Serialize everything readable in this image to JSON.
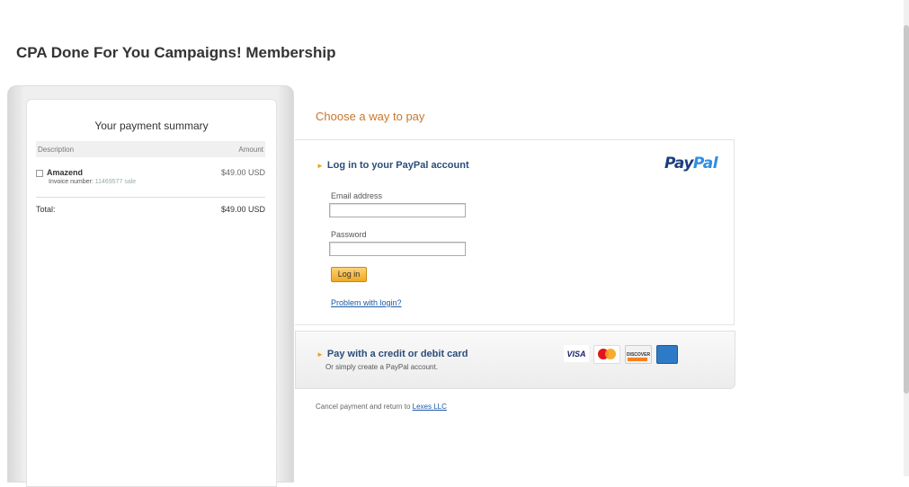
{
  "page": {
    "title": "CPA Done For You Campaigns! Membership"
  },
  "summary": {
    "title": "Your payment summary",
    "col_description": "Description",
    "col_amount": "Amount",
    "item_name": "Amazend",
    "item_amount": "$49.00 USD",
    "invoice_label": "Invoice number:",
    "invoice_number": "11469577 sale",
    "total_label": "Total:",
    "total_amount": "$49.00 USD"
  },
  "payment": {
    "heading": "Choose a way to pay",
    "login_title": "Log in to your PayPal account",
    "logo_pay": "Pay",
    "logo_pal": "Pal",
    "email_label": "Email address",
    "email_value": "",
    "password_label": "Password",
    "password_value": "",
    "login_button": "Log in",
    "problem_link": "Problem with login?",
    "card_title": "Pay with a credit or debit card",
    "card_subtitle": "Or simply create a PayPal account.",
    "card_logos": [
      "visa-logo",
      "mastercard-logo",
      "discover-logo",
      "amex-logo"
    ],
    "visa_text": "VISA",
    "discover_text": "DISCOVER",
    "cancel_text": "Cancel payment and return to",
    "cancel_link": "Lexes LLC"
  },
  "colors": {
    "heading_orange": "#c7772c",
    "title_blue": "#2b4d7a",
    "link_blue": "#1a5aa6",
    "button_gold": "#f0a820"
  }
}
